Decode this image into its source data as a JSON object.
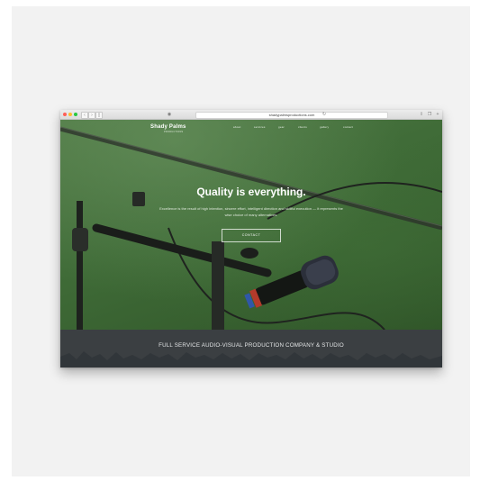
{
  "browser": {
    "url": "shadypalmsproductions.com",
    "nav_back": "‹",
    "nav_forward": "›",
    "sidebar_glyph": "▯",
    "shield_glyph": "◉",
    "reload_glyph": "↻",
    "share_glyph": "⇪",
    "tabs_glyph": "❐",
    "add_glyph": "+"
  },
  "site": {
    "logo": "Shady Palms",
    "logo_sub": "PRODUCTIONS",
    "nav": [
      "about",
      "services",
      "gear",
      "clients",
      "gallery",
      "contact"
    ],
    "headline": "Quality is everything.",
    "tagline": "Excellence is the result of high intention, sincere effort, intelligent direction and skillful execution — it represents the wise choice of many alternatives.",
    "contact_button": "CONTACT",
    "banner": "FULL SERVICE AUDIO-VISUAL PRODUCTION COMPANY & STUDIO"
  },
  "colors": {
    "hero_green": "#3f6b37",
    "strip_dark": "#3b3f42"
  }
}
